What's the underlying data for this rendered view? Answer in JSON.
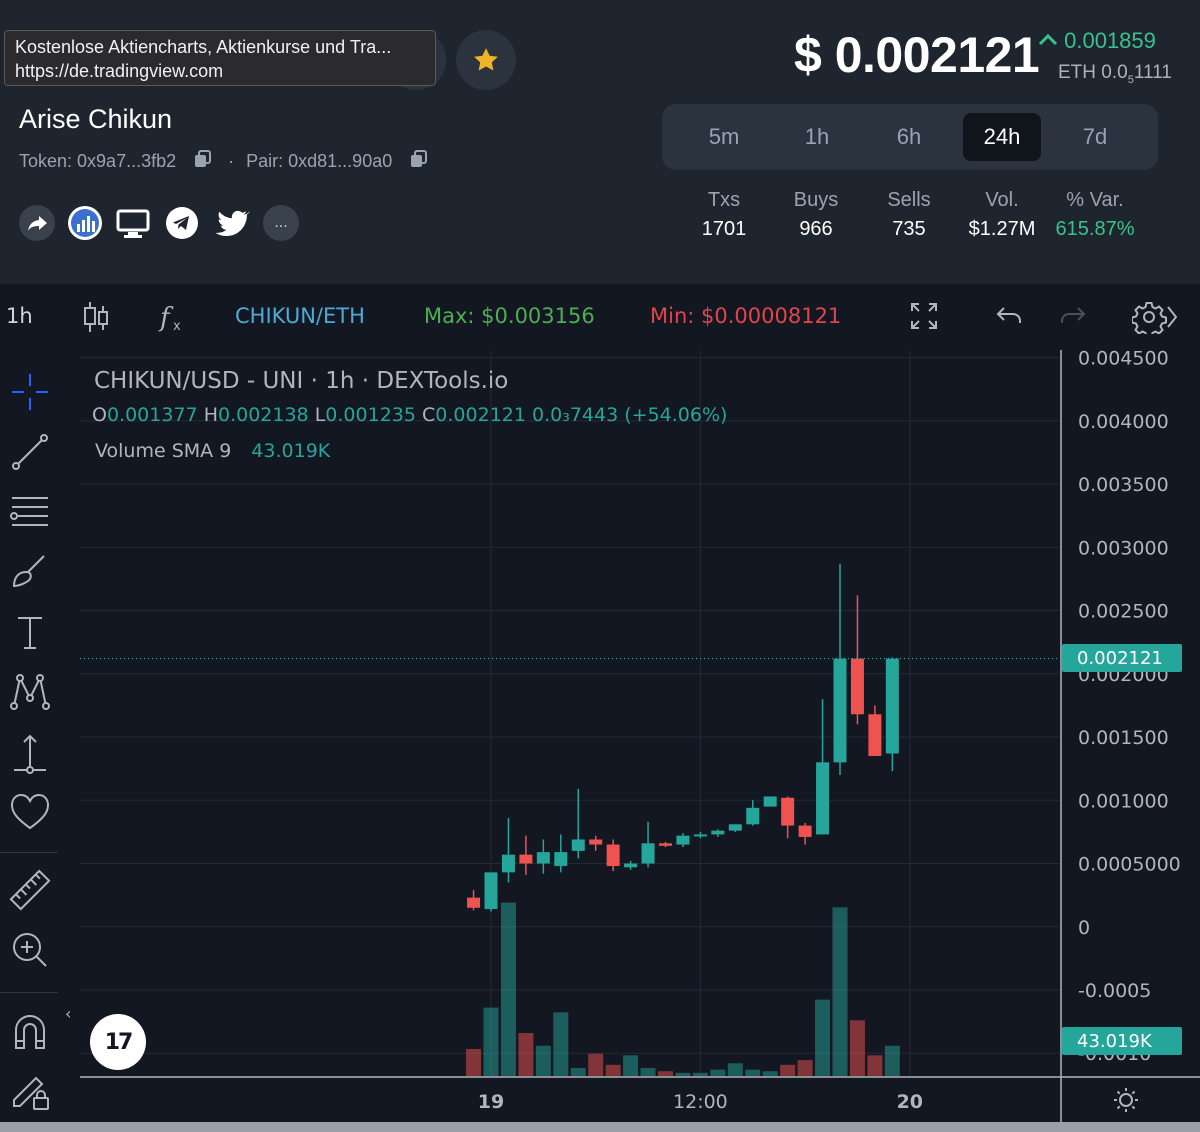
{
  "tooltip": {
    "title": "Kostenlose Aktiencharts, Aktienkurse und Tra...",
    "url": "https://de.tradingview.com"
  },
  "token": {
    "name": "Arise Chikun",
    "token_label": "Token: 0x9a7...3fb2",
    "separator": "·",
    "pair_label": "Pair: 0xd81...90a0"
  },
  "social": {
    "more_label": "..."
  },
  "price": {
    "usd": "$ 0.002121",
    "change": "0.001859",
    "eth_main": "ETH 0.0",
    "eth_sub": "5",
    "eth_tail": "1111"
  },
  "timeframes": [
    {
      "label": "5m",
      "active": false
    },
    {
      "label": "1h",
      "active": false
    },
    {
      "label": "6h",
      "active": false
    },
    {
      "label": "24h",
      "active": true
    },
    {
      "label": "7d",
      "active": false
    }
  ],
  "stats": [
    {
      "label": "Txs",
      "value": "1701",
      "color": "white"
    },
    {
      "label": "Buys",
      "value": "966",
      "color": "white"
    },
    {
      "label": "Sells",
      "value": "735",
      "color": "white"
    },
    {
      "label": "Vol.",
      "value": "$1.27M",
      "color": "white"
    },
    {
      "label": "% Var.",
      "value": "615.87%",
      "color": "green"
    }
  ],
  "toolbar": {
    "interval": "1h",
    "pair": "CHIKUN/ETH",
    "max_label": "Max: $0.003156",
    "min_label": "Min: $0.00008121"
  },
  "legend": {
    "title": "CHIKUN/USD - UNI · 1h · DEXTools.io",
    "o_label": "O",
    "o_value": "0.001377",
    "h_label": "H",
    "h_value": "0.002138",
    "l_label": "L",
    "l_value": "0.001235",
    "c_label": "C",
    "c_value": "0.002121",
    "change_text": "0.0₃7443 (+54.06%)",
    "volume_label": "Volume SMA 9",
    "volume_value": "43.019K"
  },
  "logo_text": "17",
  "colors": {
    "up": "#26a69a",
    "down": "#ef5350",
    "accent_blue": "#4fa9d8",
    "max_green": "#4caf50",
    "min_red": "#e0454a"
  },
  "chart_data": {
    "type": "candlestick",
    "title": "CHIKUN/USD - UNI · 1h · DEXTools.io",
    "y_ticks": [
      "0.004500",
      "0.004000",
      "0.003500",
      "0.003000",
      "0.002500",
      "0.002000",
      "0.001500",
      "0.001000",
      "0.0005000",
      "0",
      "-0.0005",
      "-0.0010"
    ],
    "y_tick_values": [
      0.0045,
      0.004,
      0.0035,
      0.003,
      0.0025,
      0.002,
      0.0015,
      0.001,
      0.0005,
      0,
      -0.0005,
      -0.001
    ],
    "ylim": [
      -0.00118,
      0.00456
    ],
    "x_ticks": [
      {
        "label": "19",
        "hour": 0
      },
      {
        "label": "12:00",
        "hour": 12
      },
      {
        "label": "20",
        "hour": 24
      }
    ],
    "last_price_label": "0.002121",
    "last_price": 0.002121,
    "volume_label": "43.019K",
    "volume_max": 110000,
    "candles": [
      {
        "hour": -1,
        "o": 0.00023,
        "h": 0.00029,
        "l": 0.00013,
        "c": 0.00015,
        "v": 17000
      },
      {
        "hour": 0,
        "o": 0.00014,
        "h": 0.00043,
        "l": 0.00012,
        "c": 0.00043,
        "v": 43000
      },
      {
        "hour": 1,
        "o": 0.00043,
        "h": 0.00086,
        "l": 0.00035,
        "c": 0.00057,
        "v": 109000
      },
      {
        "hour": 2,
        "o": 0.00057,
        "h": 0.00072,
        "l": 0.00041,
        "c": 0.0005,
        "v": 27000
      },
      {
        "hour": 3,
        "o": 0.0005,
        "h": 0.00069,
        "l": 0.00042,
        "c": 0.00059,
        "v": 19000
      },
      {
        "hour": 4,
        "o": 0.00048,
        "h": 0.00073,
        "l": 0.00043,
        "c": 0.00059,
        "v": 40000
      },
      {
        "hour": 5,
        "o": 0.0006,
        "h": 0.00109,
        "l": 0.00054,
        "c": 0.00069,
        "v": 5000
      },
      {
        "hour": 6,
        "o": 0.00069,
        "h": 0.00072,
        "l": 0.0006,
        "c": 0.00065,
        "v": 14000
      },
      {
        "hour": 7,
        "o": 0.00065,
        "h": 0.00069,
        "l": 0.00044,
        "c": 0.00048,
        "v": 7000
      },
      {
        "hour": 8,
        "o": 0.00047,
        "h": 0.00052,
        "l": 0.00045,
        "c": 0.0005,
        "v": 13000
      },
      {
        "hour": 9,
        "o": 0.0005,
        "h": 0.00083,
        "l": 0.00047,
        "c": 0.00066,
        "v": 5000
      },
      {
        "hour": 10,
        "o": 0.00066,
        "h": 0.00067,
        "l": 0.00063,
        "c": 0.00064,
        "v": 3000
      },
      {
        "hour": 11,
        "o": 0.00065,
        "h": 0.00074,
        "l": 0.00063,
        "c": 0.00072,
        "v": 2000
      },
      {
        "hour": 12,
        "o": 0.00072,
        "h": 0.00075,
        "l": 0.0007,
        "c": 0.00073,
        "v": 2000
      },
      {
        "hour": 13,
        "o": 0.00073,
        "h": 0.00077,
        "l": 0.00071,
        "c": 0.00076,
        "v": 4000
      },
      {
        "hour": 14,
        "o": 0.00076,
        "h": 0.00081,
        "l": 0.00075,
        "c": 0.00081,
        "v": 8000
      },
      {
        "hour": 15,
        "o": 0.00081,
        "h": 0.001,
        "l": 0.0008,
        "c": 0.00094,
        "v": 4000
      },
      {
        "hour": 16,
        "o": 0.00095,
        "h": 0.00103,
        "l": 0.00095,
        "c": 0.00103,
        "v": 3000
      },
      {
        "hour": 17,
        "o": 0.00102,
        "h": 0.00103,
        "l": 0.0007,
        "c": 0.0008,
        "v": 7000
      },
      {
        "hour": 18,
        "o": 0.0008,
        "h": 0.00082,
        "l": 0.00065,
        "c": 0.00071,
        "v": 10000
      },
      {
        "hour": 19,
        "o": 0.00073,
        "h": 0.0018,
        "l": 0.00073,
        "c": 0.0013,
        "v": 48000
      },
      {
        "hour": 20,
        "o": 0.0013,
        "h": 0.00287,
        "l": 0.0012,
        "c": 0.00212,
        "v": 106000
      },
      {
        "hour": 21,
        "o": 0.00212,
        "h": 0.00262,
        "l": 0.0016,
        "c": 0.00168,
        "v": 35000
      },
      {
        "hour": 22,
        "o": 0.00168,
        "h": 0.00175,
        "l": 0.00135,
        "c": 0.00135,
        "v": 13000
      },
      {
        "hour": 23,
        "o": 0.00137,
        "h": 0.00213,
        "l": 0.00123,
        "c": 0.00212,
        "v": 19000
      }
    ]
  }
}
